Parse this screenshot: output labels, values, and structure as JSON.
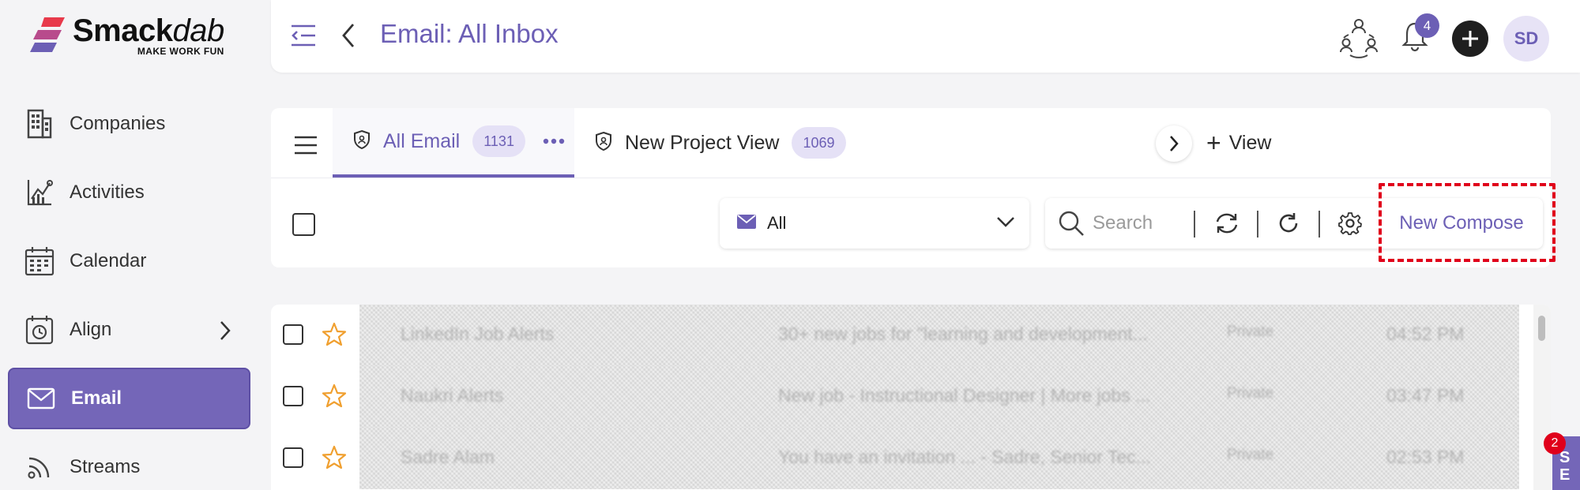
{
  "app": {
    "logo_name_bold": "Smack",
    "logo_name_italic": "dab",
    "logo_tagline": "MAKE WORK FUN"
  },
  "sidebar": {
    "items": [
      {
        "label": "Companies",
        "icon": "building-icon"
      },
      {
        "label": "Activities",
        "icon": "activities-chart-icon"
      },
      {
        "label": "Calendar",
        "icon": "calendar-icon"
      },
      {
        "label": "Align",
        "icon": "align-clock-icon"
      },
      {
        "label": "Email",
        "icon": "mail-icon",
        "active": true
      },
      {
        "label": "Streams",
        "icon": "rss-icon"
      }
    ]
  },
  "header": {
    "title": "Email: All Inbox",
    "notification_count": "4",
    "avatar_initials": "SD"
  },
  "views": {
    "tabs": [
      {
        "label": "All Email",
        "count": "1131",
        "active": true
      },
      {
        "label": "New  Project View",
        "count": "1069"
      }
    ],
    "add_view_label": "View"
  },
  "toolbar": {
    "filter_value": "All",
    "search_placeholder": "Search",
    "compose_label": "New Compose"
  },
  "emails": [
    {
      "from": "LinkedIn Job Alerts",
      "subject": "30+ new jobs for \"learning and development...",
      "privacy": "Private",
      "time": "04:52 PM"
    },
    {
      "from": "Naukri Alerts",
      "subject": "New job - Instructional Designer | More jobs ...",
      "privacy": "Private",
      "time": "03:47 PM"
    },
    {
      "from": "Sadre Alam",
      "subject": "You have an invitation ... - Sadre, Senior Tec...",
      "privacy": "Private",
      "time": "02:53 PM"
    }
  ],
  "widget": {
    "badge": "2",
    "label": "S E"
  },
  "colors": {
    "accent": "#6c5fb5",
    "active_nav": "#7466b8",
    "highlight": "#e0001b",
    "star": "#f0a030"
  }
}
